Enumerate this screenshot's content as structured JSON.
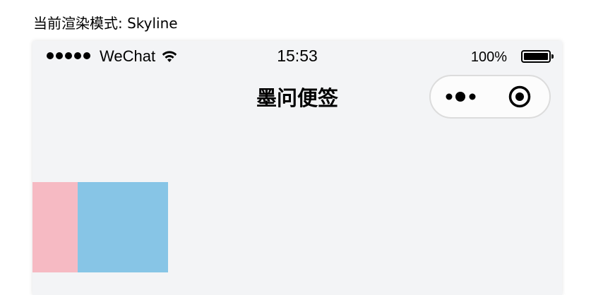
{
  "render_mode_label": "当前渲染模式: Skyline",
  "status_bar": {
    "signal_icon": "signal-dots-icon",
    "carrier": "WeChat",
    "wifi_icon": "wifi-icon",
    "time": "15:53",
    "battery_percent": "100%",
    "battery_icon": "battery-icon",
    "battery_level": 1.0
  },
  "nav_bar": {
    "title": "墨问便签",
    "capsule": {
      "menu_icon": "more-dots-icon",
      "close_icon": "target-circle-icon"
    }
  },
  "content": {
    "blocks": [
      {
        "name": "pink-block",
        "color": "#f6bac3"
      },
      {
        "name": "blue-block",
        "color": "#87c5e6"
      }
    ]
  },
  "colors": {
    "page_background": "#f3f4f6",
    "text": "#000000"
  }
}
